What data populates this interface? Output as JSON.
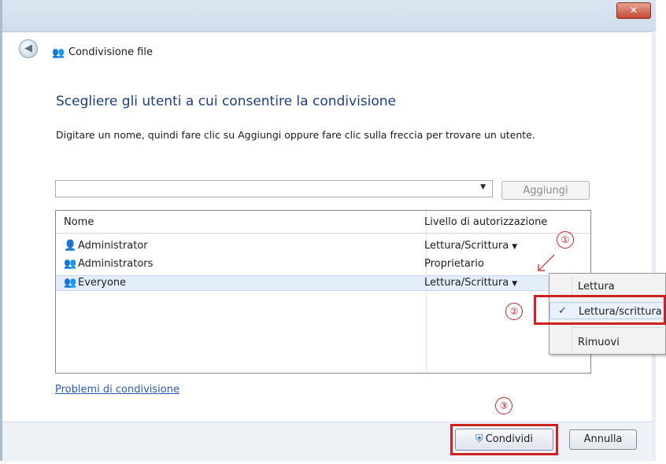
{
  "window": {
    "title": "Condivisione file",
    "close_label": "✕"
  },
  "main": {
    "heading": "Scegliere gli utenti a cui consentire la condivisione",
    "instruction": "Digitare un nome, quindi fare clic su Aggiungi oppure fare clic sulla freccia per trovare un utente.",
    "name_input_value": "",
    "add_button": "Aggiungi"
  },
  "table": {
    "headers": {
      "name": "Nome",
      "level": "Livello di autorizzazione"
    },
    "rows": [
      {
        "name": "Administrator",
        "level": "Lettura/Scrittura",
        "icon": "user-icon",
        "has_dropdown": true
      },
      {
        "name": "Administrators",
        "level": "Proprietario",
        "icon": "group-icon",
        "has_dropdown": false
      },
      {
        "name": "Everyone",
        "level": "Lettura/Scrittura",
        "icon": "group-icon",
        "has_dropdown": true,
        "selected": true
      }
    ]
  },
  "context_menu": {
    "items": [
      {
        "label": "Lettura",
        "checked": false
      },
      {
        "label": "Lettura/scrittura",
        "checked": true
      },
      {
        "label": "Rimuovi",
        "checked": false
      }
    ],
    "check_mark": "✓"
  },
  "annotations": [
    "①",
    "②",
    "③"
  ],
  "link": {
    "problems": "Problemi di condivisione"
  },
  "buttons": {
    "share": "Condividi",
    "cancel": "Annulla"
  },
  "colors": {
    "heading": "#1e3f7a",
    "link": "#2b58b3",
    "annotation": "#cc2222",
    "selection": "#e4eefb"
  }
}
